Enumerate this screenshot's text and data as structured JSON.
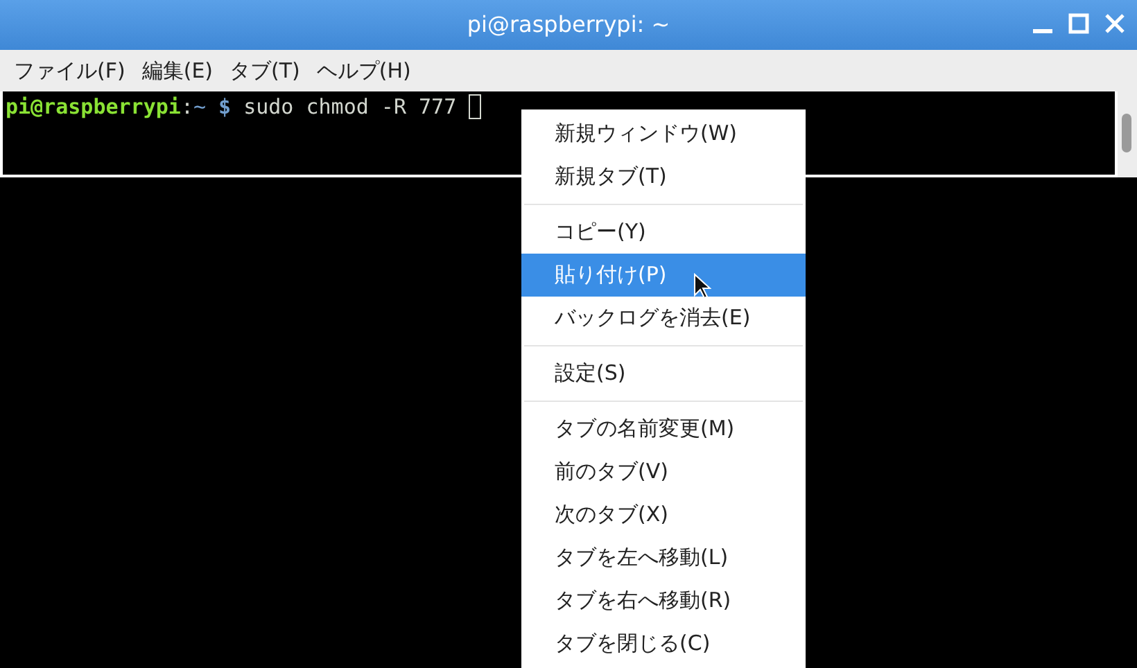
{
  "window": {
    "title": "pi@raspberrypi: ~"
  },
  "menubar": [
    "ファイル(F)",
    "編集(E)",
    "タブ(T)",
    "ヘルプ(H)"
  ],
  "terminal": {
    "segments": [
      {
        "kind": "userhost",
        "text": "pi@raspberrypi"
      },
      {
        "kind": "colon",
        "text": ":"
      },
      {
        "kind": "path",
        "text": "~"
      },
      {
        "kind": "symbol",
        "text": " $"
      },
      {
        "kind": "command",
        "text": " sudo chmod -R 777 "
      }
    ]
  },
  "context_menu": [
    {
      "kind": "item",
      "label": "新規ウィンドウ(W)",
      "selected": false
    },
    {
      "kind": "item",
      "label": "新規タブ(T)",
      "selected": false
    },
    {
      "kind": "separator"
    },
    {
      "kind": "item",
      "label": "コピー(Y)",
      "selected": false
    },
    {
      "kind": "item",
      "label": "貼り付け(P)",
      "selected": true
    },
    {
      "kind": "item",
      "label": "バックログを消去(E)",
      "selected": false
    },
    {
      "kind": "separator"
    },
    {
      "kind": "item",
      "label": "設定(S)",
      "selected": false
    },
    {
      "kind": "separator"
    },
    {
      "kind": "item",
      "label": "タブの名前変更(M)",
      "selected": false
    },
    {
      "kind": "item",
      "label": "前のタブ(V)",
      "selected": false
    },
    {
      "kind": "item",
      "label": "次のタブ(X)",
      "selected": false
    },
    {
      "kind": "item",
      "label": "タブを左へ移動(L)",
      "selected": false
    },
    {
      "kind": "item",
      "label": "タブを右へ移動(R)",
      "selected": false
    },
    {
      "kind": "item",
      "label": "タブを閉じる(C)",
      "selected": false
    }
  ]
}
